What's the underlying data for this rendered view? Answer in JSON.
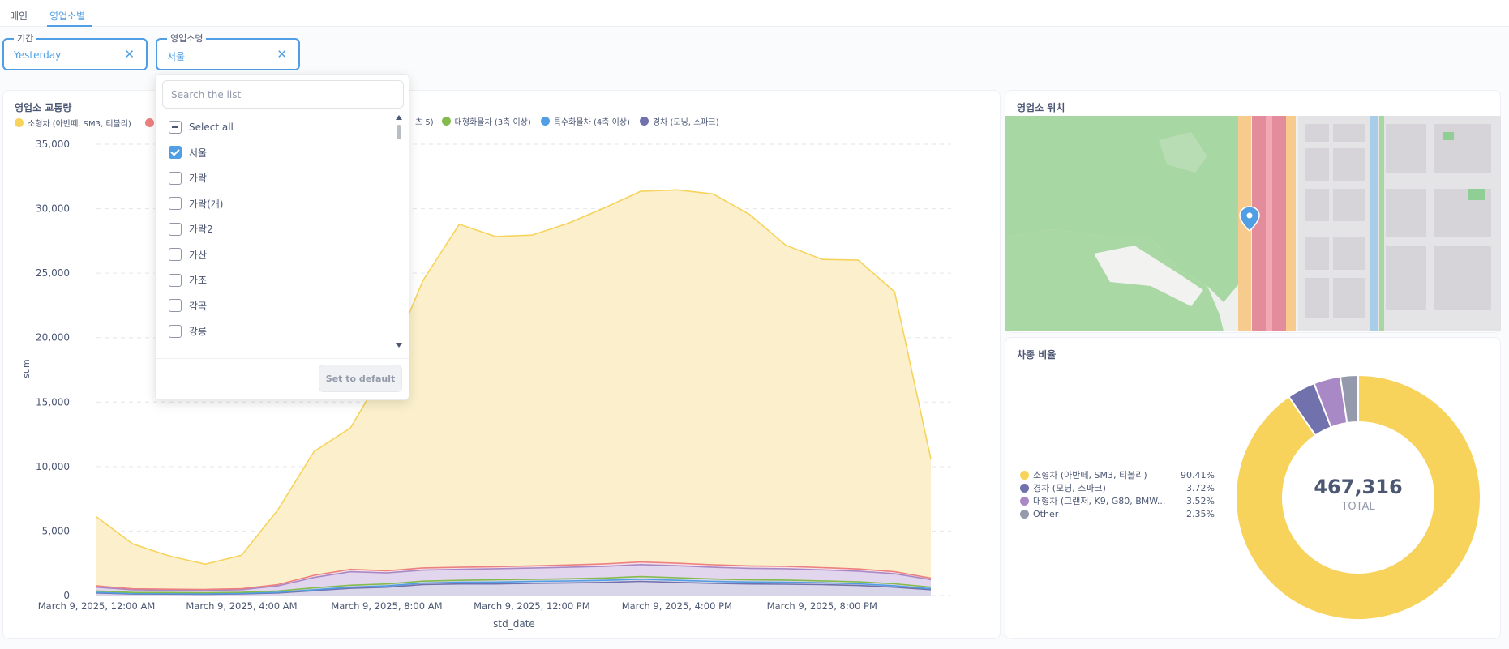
{
  "tabs": [
    {
      "label": "메인",
      "active": false
    },
    {
      "label": "영업소별",
      "active": true
    }
  ],
  "filters": {
    "period": {
      "label": "기간",
      "value": "Yesterday"
    },
    "office": {
      "label": "영업소명",
      "value": "서울"
    }
  },
  "traffic_card": {
    "title": "영업소 교통량",
    "legend": [
      {
        "name": "소형차 (아반떼, SM3, 티볼리)",
        "color": "#f7d35b"
      },
      {
        "name": "",
        "color": "#ed8080"
      },
      {
        "name": "츠 5)",
        "color": ""
      },
      {
        "name": "대형화물차 (3축 이상)",
        "color": "#84bb4c"
      },
      {
        "name": "특수화물차 (4축 이상)",
        "color": "#509ee3"
      },
      {
        "name": "경차 (모닝, 스파크)",
        "color": "#7172ad"
      }
    ]
  },
  "chart_data": {
    "type": "area",
    "stacked": true,
    "xlabel": "std_date",
    "ylabel": "sum",
    "ylim": [
      0,
      35000
    ],
    "yticks": [
      "0",
      "5,000",
      "10,000",
      "15,000",
      "20,000",
      "25,000",
      "30,000",
      "35,000"
    ],
    "xticks": [
      {
        "hour": 0,
        "label": "March 9, 2025, 12:00 AM"
      },
      {
        "hour": 4,
        "label": "March 9, 2025, 4:00 AM"
      },
      {
        "hour": 8,
        "label": "March 9, 2025, 8:00 AM"
      },
      {
        "hour": 12,
        "label": "March 9, 2025, 12:00 PM"
      },
      {
        "hour": 16,
        "label": "March 9, 2025, 4:00 PM"
      },
      {
        "hour": 20,
        "label": "March 9, 2025, 8:00 PM"
      }
    ],
    "x": [
      0,
      1,
      2,
      3,
      4,
      5,
      6,
      7,
      8,
      9,
      10,
      11,
      12,
      13,
      14,
      15,
      16,
      17,
      18,
      19,
      20,
      21,
      22,
      23
    ],
    "series": [
      {
        "name": "경차 (모닝, 스파크)",
        "color": "#7172ad",
        "fill": "#d9d6ea",
        "values": [
          200,
          120,
          110,
          100,
          130,
          200,
          380,
          560,
          650,
          850,
          900,
          900,
          950,
          980,
          1020,
          1100,
          1020,
          950,
          900,
          880,
          850,
          780,
          650,
          450
        ]
      },
      {
        "name": "특수화물차 (4축 이상)",
        "color": "#509ee3",
        "fill": "#d9d6ea",
        "values": [
          50,
          40,
          40,
          40,
          40,
          50,
          70,
          90,
          100,
          120,
          130,
          140,
          150,
          150,
          160,
          170,
          160,
          150,
          150,
          150,
          140,
          130,
          110,
          80
        ]
      },
      {
        "name": "대형화물차 (3축 이상)",
        "color": "#84bb4c",
        "fill": "#d9d6ea",
        "values": [
          100,
          80,
          80,
          80,
          80,
          100,
          150,
          150,
          150,
          150,
          150,
          180,
          160,
          170,
          180,
          200,
          200,
          180,
          170,
          170,
          150,
          150,
          150,
          120
        ]
      },
      {
        "name": "",
        "color": "#a989c5",
        "fill": "#e2d6ee",
        "values": [
          300,
          200,
          180,
          170,
          200,
          400,
          800,
          1050,
          850,
          850,
          850,
          860,
          870,
          890,
          910,
          930,
          930,
          910,
          890,
          880,
          850,
          830,
          780,
          580
        ]
      },
      {
        "name": "",
        "color": "#ed8080",
        "fill": "#f6dfe6",
        "values": [
          100,
          80,
          80,
          80,
          80,
          100,
          170,
          180,
          170,
          170,
          160,
          160,
          170,
          180,
          190,
          200,
          200,
          200,
          190,
          190,
          180,
          170,
          160,
          120
        ]
      },
      {
        "name": "소형차 (아반떼, SM3, 티볼리)",
        "color": "#f7d35b",
        "fill": "#fbf0cb",
        "values": [
          5350,
          3480,
          2580,
          1960,
          2590,
          5800,
          9600,
          10980,
          15800,
          22300,
          26600,
          25600,
          25650,
          26500,
          27600,
          28750,
          28950,
          28750,
          27250,
          24900,
          23900,
          23950,
          21700,
          9250
        ]
      }
    ]
  },
  "map_card": {
    "title": "영업소 위치"
  },
  "pie_card": {
    "title": "차종 비율",
    "total_value": "467,316",
    "total_label": "TOTAL",
    "slices": [
      {
        "name": "소형차 (아반떼, SM3, 티볼리)",
        "pct_label": "90.41%",
        "value": 90.41,
        "color": "#f7d35b"
      },
      {
        "name": "경차 (모닝, 스파크)",
        "pct_label": "3.72%",
        "value": 3.72,
        "color": "#7172ad"
      },
      {
        "name": "대형차 (그랜저, K9, G80, BMW...",
        "pct_label": "3.52%",
        "value": 3.52,
        "color": "#a989c5"
      },
      {
        "name": "Other",
        "pct_label": "2.35%",
        "value": 2.35,
        "color": "#949aab"
      }
    ]
  },
  "dropdown": {
    "search_placeholder": "Search the list",
    "select_all": "Select all",
    "items": [
      {
        "label": "서울",
        "checked": true
      },
      {
        "label": "가락",
        "checked": false
      },
      {
        "label": "가락(개)",
        "checked": false
      },
      {
        "label": "가락2",
        "checked": false
      },
      {
        "label": "가산",
        "checked": false
      },
      {
        "label": "가조",
        "checked": false
      },
      {
        "label": "감곡",
        "checked": false
      },
      {
        "label": "강릉",
        "checked": false
      }
    ],
    "default_button": "Set to default"
  }
}
